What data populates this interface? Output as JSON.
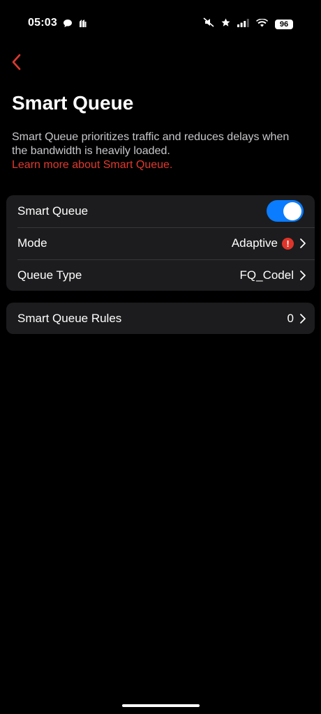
{
  "status_bar": {
    "time": "05:03",
    "battery": "96",
    "icons": [
      "chat-bubble-icon",
      "app-notification-icon",
      "silent-mode-icon",
      "star-icon",
      "cellular-signal-icon",
      "wifi-icon",
      "battery-icon"
    ]
  },
  "header": {
    "back_icon": "chevron-left-icon",
    "title": "Smart Queue"
  },
  "description": {
    "text": "Smart Queue prioritizes traffic and reduces delays when the bandwidth is heavily loaded.",
    "link": "Learn more about Smart Queue."
  },
  "settings": {
    "smart_queue": {
      "label": "Smart Queue",
      "enabled": true
    },
    "mode": {
      "label": "Mode",
      "value": "Adaptive",
      "alert": "!"
    },
    "queue_type": {
      "label": "Queue Type",
      "value": "FQ_Codel"
    }
  },
  "rules": {
    "label": "Smart Queue Rules",
    "value": "0"
  },
  "colors": {
    "accent": "#e13a2f",
    "toggle_on": "#0a7cff",
    "card": "#1c1c1e",
    "background": "#000000"
  }
}
